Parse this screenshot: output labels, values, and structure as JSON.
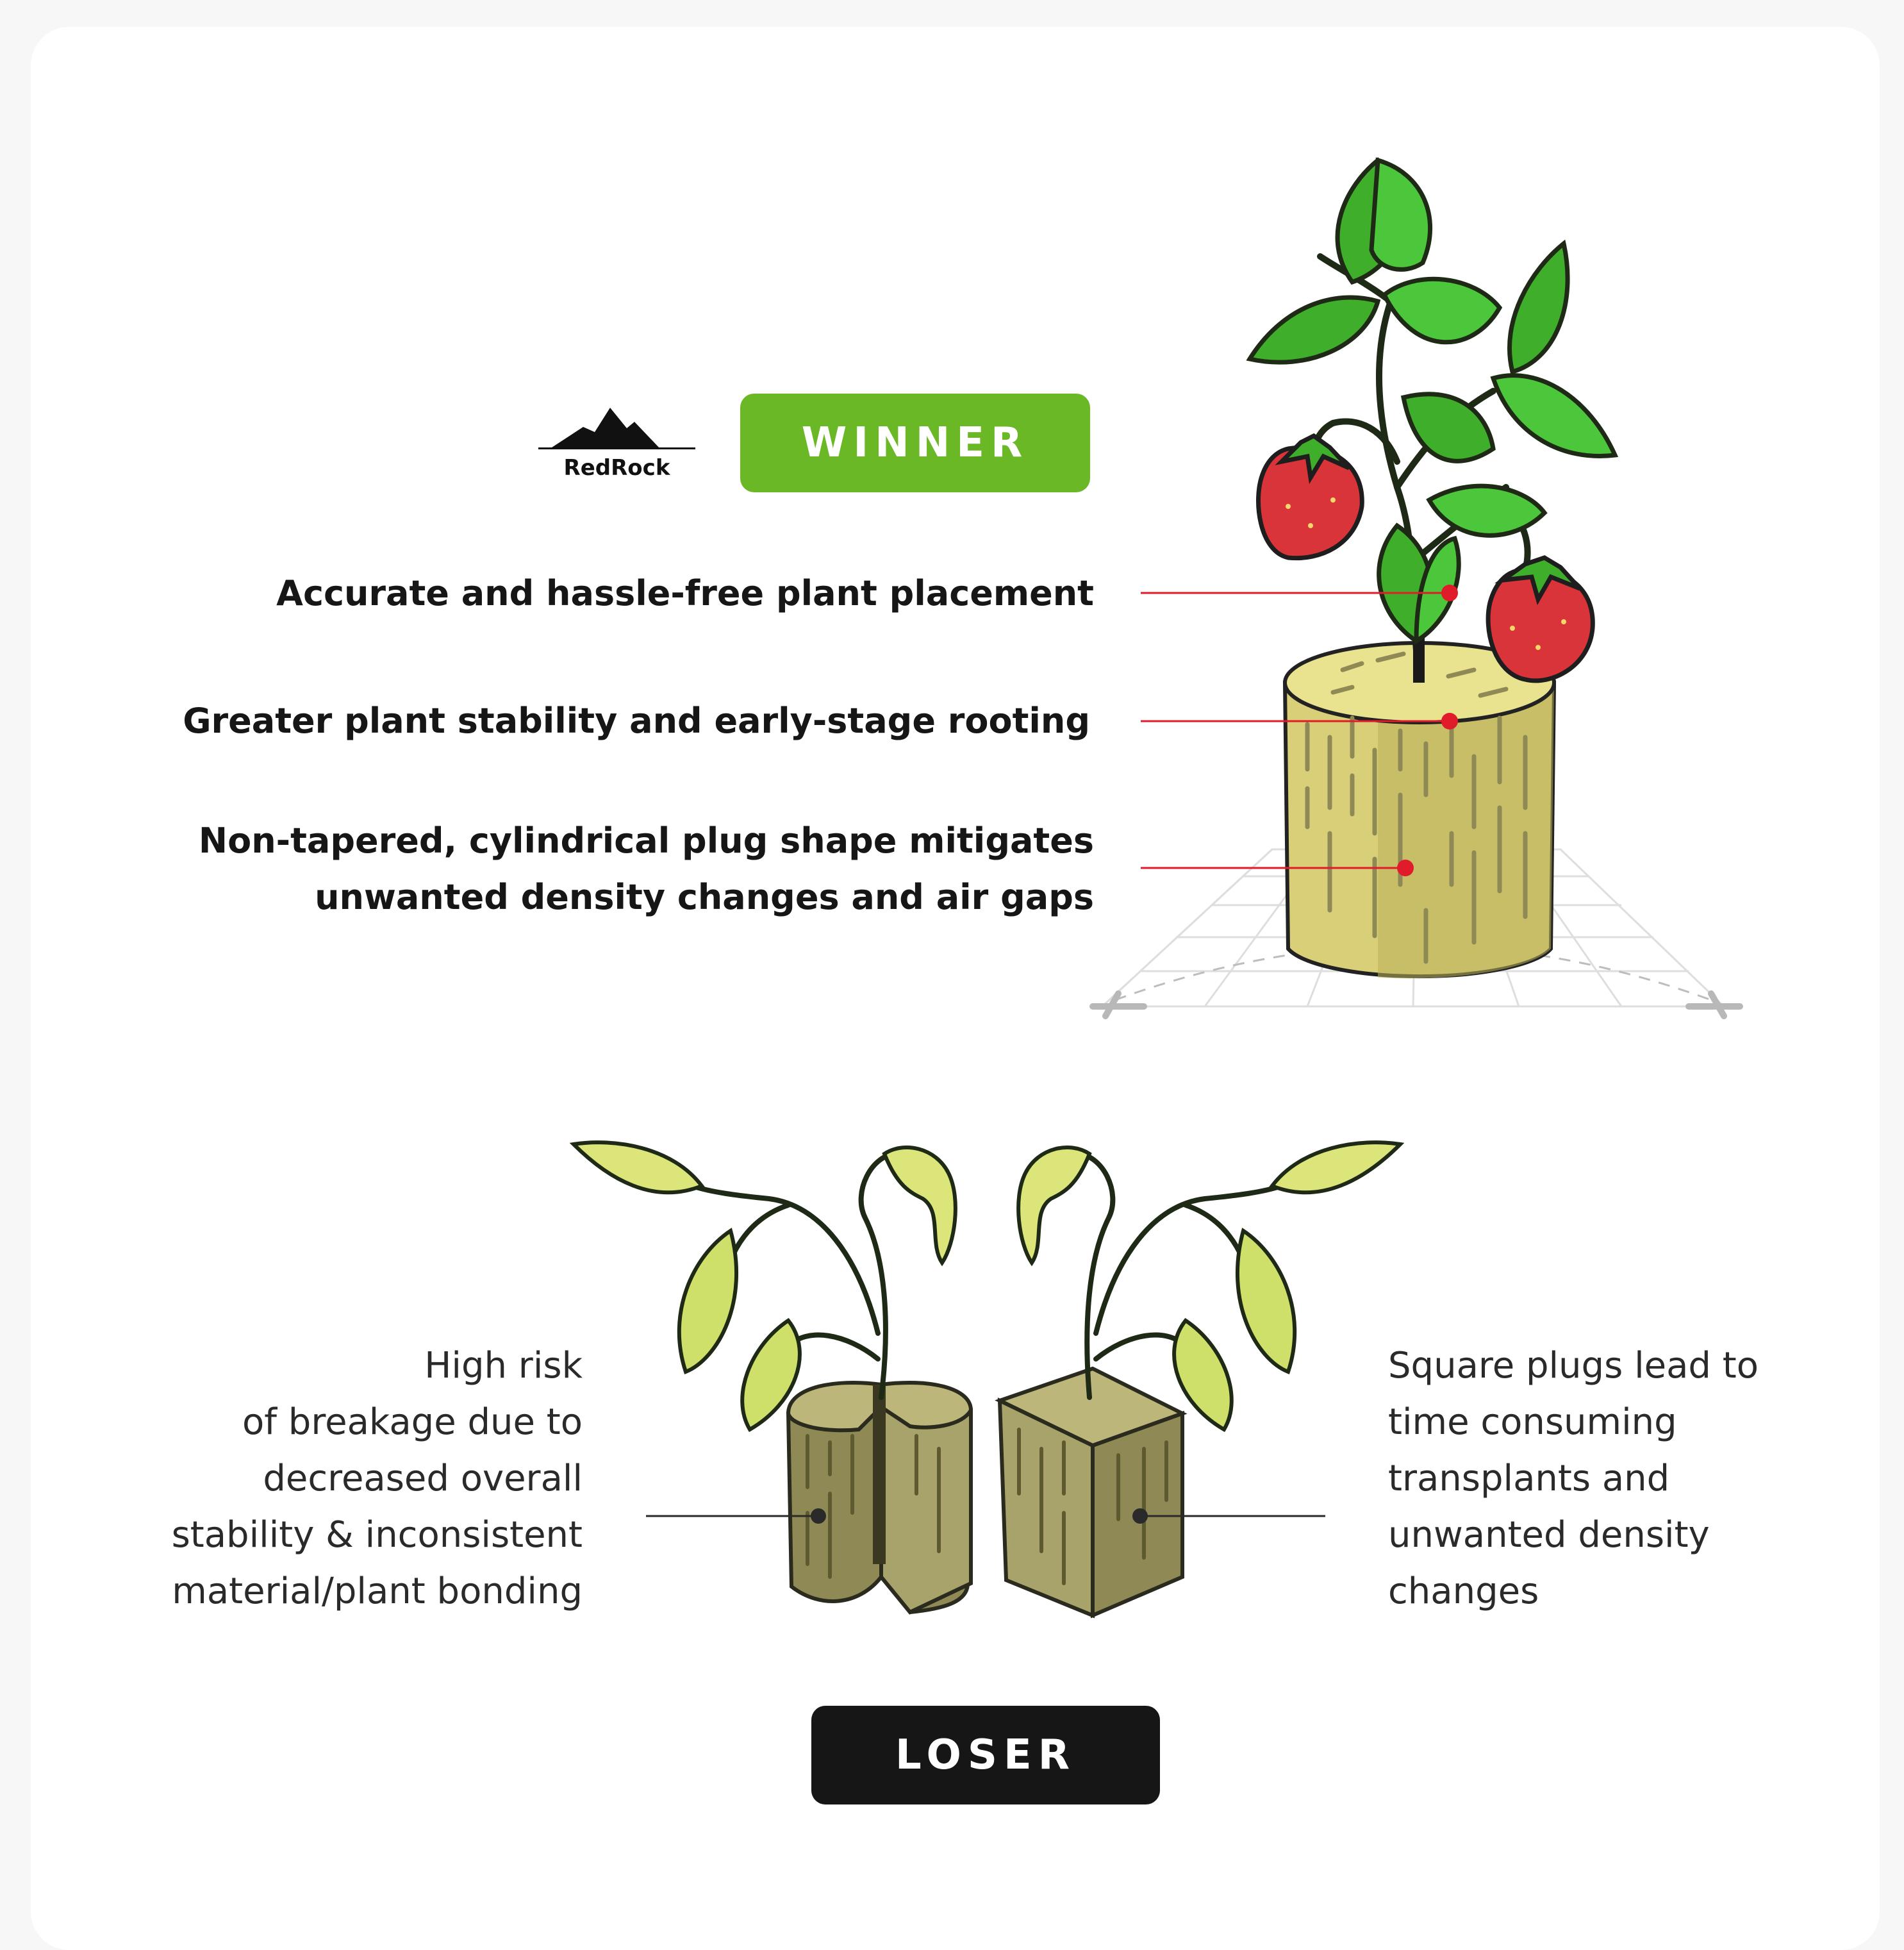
{
  "brand": {
    "logo_text": "RedRock"
  },
  "winner": {
    "badge": "WINNER",
    "features": [
      {
        "lines": [
          "Accurate and hassle-free plant placement"
        ]
      },
      {
        "lines": [
          "Greater plant stability and early-stage rooting"
        ]
      },
      {
        "lines": [
          "Non-tapered, cylindrical plug shape mitigates",
          "unwanted density changes and air gaps"
        ]
      }
    ]
  },
  "loser": {
    "badge": "LOSER",
    "left_note": [
      "High risk",
      "of breakage due to",
      "decreased overall",
      "stability & inconsistent",
      "material/plant bonding"
    ],
    "right_note": [
      "Square plugs lead to",
      "time consuming",
      "transplants and",
      "unwanted density",
      "changes"
    ]
  },
  "colors": {
    "winner_green": "#6ab825",
    "loser_black": "#161616",
    "callout_red": "#e01b2a",
    "plug_yellow": "#d8cf78",
    "plug_olive": "#8f8a55",
    "leaf_green": "#3fae2a",
    "strawberry_red": "#d9343a"
  },
  "icons": [
    "mountain-logo-icon",
    "strawberry-plant-illustration",
    "cylinder-plug-illustration",
    "wilting-seedlings-illustration"
  ]
}
